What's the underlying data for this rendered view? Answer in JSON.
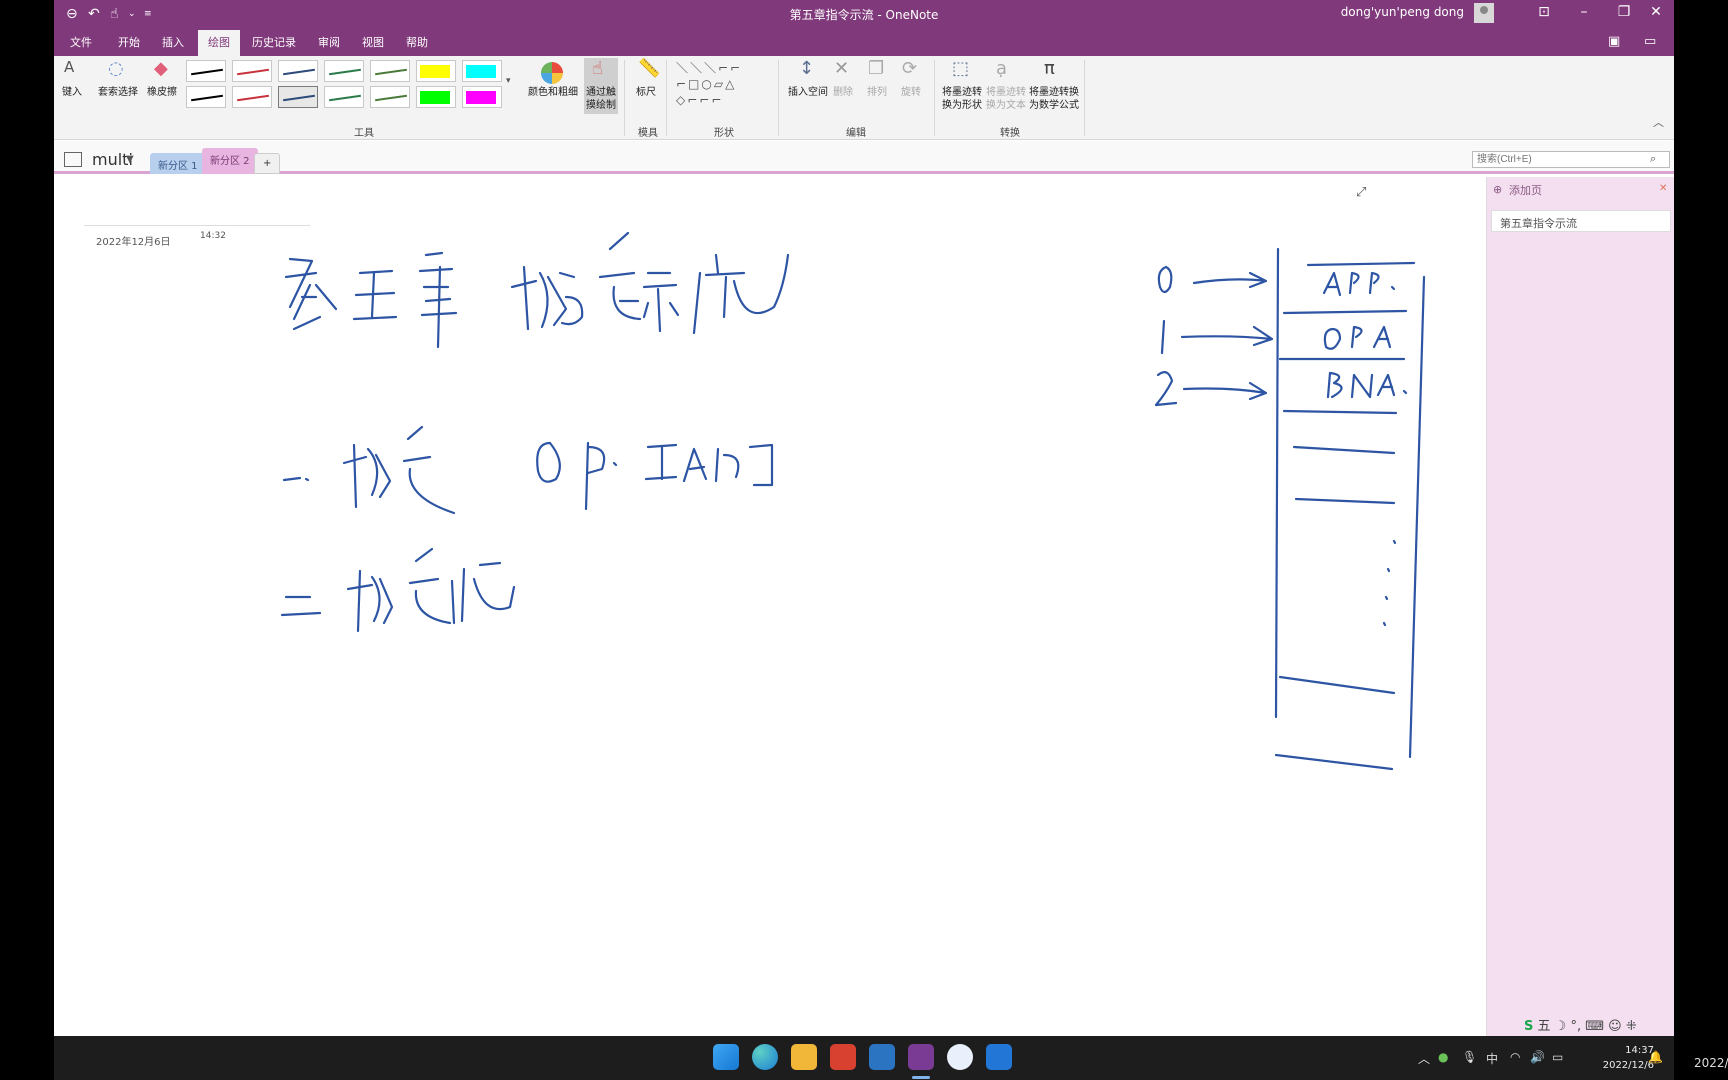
{
  "window": {
    "title": "第五章指令示流 - OneNote",
    "user": "dong'yun'peng dong"
  },
  "menu": {
    "tabs": [
      "文件",
      "开始",
      "插入",
      "绘图",
      "历史记录",
      "审阅",
      "视图",
      "帮助"
    ],
    "active_tab": "绘图"
  },
  "ribbon": {
    "tools_group": "工具",
    "type_label": "键入",
    "lasso_label": "套索选择",
    "eraser_label": "橡皮擦",
    "color_thickness_label": "颜色和粗细",
    "touch_draw_label": "通过触摸绘制",
    "ruler_label": "标尺",
    "stencils_group": "模具",
    "shapes_group": "形状",
    "insert_space_label": "插入空间",
    "delete_label": "删除",
    "arrange_label": "排列",
    "rotate_label": "旋转",
    "edit_group": "编辑",
    "ink_to_shape_label": "将墨迹转换为形状",
    "ink_to_text_label": "将墨迹转换为文本",
    "ink_to_math_label": "将墨迹转换为数学公式",
    "convert_group": "转换",
    "pen_colors": [
      "#000000",
      "#c8323c",
      "#2d4a7a",
      "#2a7a4a",
      "#4a7a3a"
    ],
    "highlighters": [
      "#ffff00",
      "#00ffff",
      "#00ff00",
      "#ff00ff"
    ]
  },
  "notebook": {
    "name": "multi",
    "sections": [
      "新分区 1",
      "新分区 2"
    ],
    "active_section": "新分区 2",
    "add_section": "+",
    "search_placeholder": "搜索(Ctrl+E)"
  },
  "page": {
    "date": "2022年12月6日",
    "time": "14:32",
    "ink_color": "#2d55a4"
  },
  "page_list": {
    "add_page": "添加页",
    "pages": [
      "第五章指令示流"
    ]
  },
  "ime": {
    "label": "五"
  },
  "taskbar": {
    "tray_lang": "中",
    "time": "14:37",
    "date": "2022/12/6",
    "edge_clip": "2022/"
  }
}
